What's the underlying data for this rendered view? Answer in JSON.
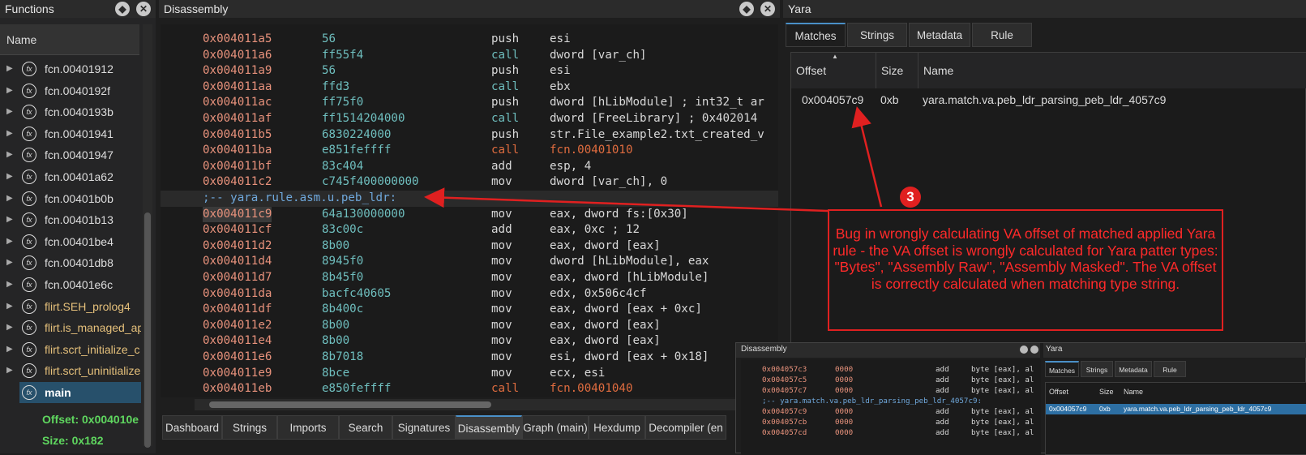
{
  "functions": {
    "title": "Functions",
    "header": "Name",
    "items": [
      {
        "label": "fcn.00401912",
        "color": "#dddddd"
      },
      {
        "label": "fcn.0040192f",
        "color": "#dddddd"
      },
      {
        "label": "fcn.0040193b",
        "color": "#dddddd"
      },
      {
        "label": "fcn.00401941",
        "color": "#dddddd"
      },
      {
        "label": "fcn.00401947",
        "color": "#dddddd"
      },
      {
        "label": "fcn.00401a62",
        "color": "#dddddd"
      },
      {
        "label": "fcn.00401b0b",
        "color": "#dddddd"
      },
      {
        "label": "fcn.00401b13",
        "color": "#dddddd"
      },
      {
        "label": "fcn.00401be4",
        "color": "#dddddd"
      },
      {
        "label": "fcn.00401db8",
        "color": "#dddddd"
      },
      {
        "label": "fcn.00401e6c",
        "color": "#dddddd"
      },
      {
        "label": "flirt.SEH_prolog4",
        "color": "#e5c07b"
      },
      {
        "label": "flirt.is_managed_ap",
        "color": "#e5c07b"
      },
      {
        "label": "flirt.scrt_initialize_c",
        "color": "#e5c07b"
      },
      {
        "label": "flirt.scrt_uninitialize",
        "color": "#e5c07b"
      },
      {
        "label": "main",
        "color": "#ffffff"
      }
    ],
    "details": [
      {
        "label": "Offset: 0x004010e"
      },
      {
        "label": "Size: 0x182"
      }
    ]
  },
  "disassembly": {
    "title": "Disassembly",
    "lines": [
      {
        "addr": "0x004011a5",
        "bytes": "56",
        "mnemonic": "push",
        "operands": "esi"
      },
      {
        "addr": "0x004011a6",
        "bytes": "ff55f4",
        "mnemonic": "call",
        "operands": "dword [var_ch]"
      },
      {
        "addr": "0x004011a9",
        "bytes": "56",
        "mnemonic": "push",
        "operands": "esi"
      },
      {
        "addr": "0x004011aa",
        "bytes": "ffd3",
        "mnemonic": "call",
        "operands": "ebx"
      },
      {
        "addr": "0x004011ac",
        "bytes": "ff75f0",
        "mnemonic": "push",
        "operands": "dword [hLibModule] ; int32_t ar"
      },
      {
        "addr": "0x004011af",
        "bytes": "ff1514204000",
        "mnemonic": "call",
        "operands": "dword [FreeLibrary] ; 0x402014"
      },
      {
        "addr": "0x004011b5",
        "bytes": "6830224000",
        "mnemonic": "push",
        "operands": "str.File_example2.txt_created_v"
      },
      {
        "addr": "0x004011ba",
        "bytes": "e851feffff",
        "mnemonic": "call",
        "operands": "fcn.00401010"
      },
      {
        "addr": "0x004011bf",
        "bytes": "83c404",
        "mnemonic": "add",
        "operands": "esp, 4"
      },
      {
        "addr": "0x004011c2",
        "bytes": "c745f400000000",
        "mnemonic": "mov",
        "operands": "dword [var_ch], 0"
      },
      {
        "flag": ";-- yara.rule.asm.u.peb_ldr:"
      },
      {
        "addr": "0x004011c9",
        "bytes": "64a130000000",
        "mnemonic": "mov",
        "operands": "eax, dword fs:[0x30]"
      },
      {
        "addr": "0x004011cf",
        "bytes": "83c00c",
        "mnemonic": "add",
        "operands": "eax, 0xc ; 12"
      },
      {
        "addr": "0x004011d2",
        "bytes": "8b00",
        "mnemonic": "mov",
        "operands": "eax, dword [eax]"
      },
      {
        "addr": "0x004011d4",
        "bytes": "8945f0",
        "mnemonic": "mov",
        "operands": "dword [hLibModule], eax"
      },
      {
        "addr": "0x004011d7",
        "bytes": "8b45f0",
        "mnemonic": "mov",
        "operands": "eax, dword [hLibModule]"
      },
      {
        "addr": "0x004011da",
        "bytes": "bacfc40605",
        "mnemonic": "mov",
        "operands": "edx, 0x506c4cf"
      },
      {
        "addr": "0x004011df",
        "bytes": "8b400c",
        "mnemonic": "mov",
        "operands": "eax, dword [eax + 0xc]"
      },
      {
        "addr": "0x004011e2",
        "bytes": "8b00",
        "mnemonic": "mov",
        "operands": "eax, dword [eax]"
      },
      {
        "addr": "0x004011e4",
        "bytes": "8b00",
        "mnemonic": "mov",
        "operands": "eax, dword [eax]"
      },
      {
        "addr": "0x004011e6",
        "bytes": "8b7018",
        "mnemonic": "mov",
        "operands": "esi, dword [eax + 0x18]"
      },
      {
        "addr": "0x004011e9",
        "bytes": "8bce",
        "mnemonic": "mov",
        "operands": "ecx, esi"
      },
      {
        "addr": "0x004011eb",
        "bytes": "e850feffff",
        "mnemonic": "call",
        "operands": "fcn.00401040"
      }
    ]
  },
  "bottom_tabs": [
    "Dashboard",
    "Strings",
    "Imports",
    "Search",
    "Signatures",
    "Disassembly",
    "Graph (main)",
    "Hexdump",
    "Decompiler (en"
  ],
  "active_tab": "Disassembly",
  "yara": {
    "title": "Yara",
    "tabs": [
      "Matches",
      "Strings",
      "Metadata",
      "Rule"
    ],
    "columns": [
      "Offset",
      "Size",
      "Name"
    ],
    "row": {
      "offset": "0x004057c9",
      "size": "0xb",
      "name": "yara.match.va.peb_ldr_parsing_peb_ldr_4057c9"
    }
  },
  "annotation": {
    "badge": "3",
    "text": "Bug in wrongly calculating VA offset of matched applied Yara rule - the VA offset is wrongly calculated for Yara patter types: \"Bytes\", \"Assembly Raw\", \"Assembly Masked\". The VA offset is correctly calculated when matching type string.",
    "color": "#e02020"
  },
  "inset": {
    "disasm_title": "Disassembly",
    "yara_title": "Yara",
    "lines": [
      {
        "addr": "0x004057c3",
        "bytes": "0000",
        "mnemonic": "add",
        "operands": "byte [eax], al"
      },
      {
        "addr": "0x004057c5",
        "bytes": "0000",
        "mnemonic": "add",
        "operands": "byte [eax], al"
      },
      {
        "addr": "0x004057c7",
        "bytes": "0000",
        "mnemonic": "add",
        "operands": "byte [eax], al"
      },
      {
        "flag": ";-- yara.match.va.peb_ldr_parsing_peb_ldr_4057c9:"
      },
      {
        "addr": "0x004057c9",
        "bytes": "0000",
        "mnemonic": "add",
        "operands": "byte [eax], al"
      },
      {
        "addr": "0x004057cb",
        "bytes": "0000",
        "mnemonic": "add",
        "operands": "byte [eax], al"
      },
      {
        "addr": "0x004057cd",
        "bytes": "0000",
        "mnemonic": "add",
        "operands": "byte [eax], al"
      }
    ],
    "yara_tabs": [
      "Matches",
      "Strings",
      "Metadata",
      "Rule"
    ],
    "columns": [
      "Offset",
      "Size",
      "Name"
    ],
    "row": {
      "offset": "0x004057c9",
      "size": "0xb",
      "name": "yara.match.va.peb_ldr_parsing_peb_ldr_4057c9"
    }
  }
}
